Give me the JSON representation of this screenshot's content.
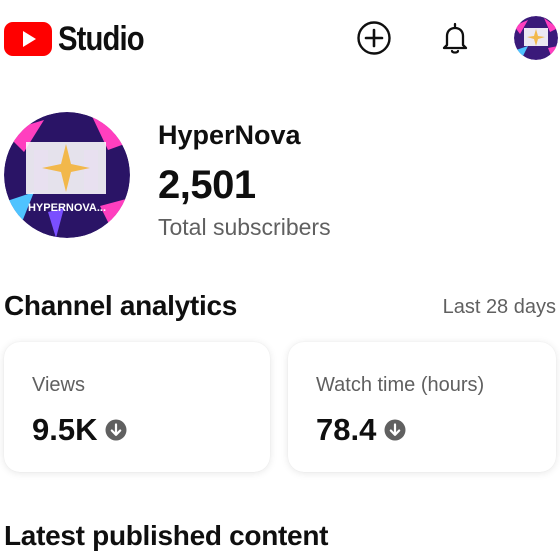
{
  "header": {
    "app_name": "Studio",
    "icons": [
      "youtube-logo-icon",
      "create-plus-icon",
      "bell-icon",
      "account-avatar"
    ]
  },
  "channel": {
    "name": "HyperNova",
    "subscriber_count": "2,501",
    "subscriber_label": "Total subscribers",
    "avatar_text": "HYPERNOVA..."
  },
  "analytics": {
    "title": "Channel analytics",
    "period": "Last 28 days",
    "cards": [
      {
        "label": "Views",
        "value": "9.5K",
        "trend": "down"
      },
      {
        "label": "Watch time (hours)",
        "value": "78.4",
        "trend": "down"
      }
    ]
  },
  "latest": {
    "title": "Latest published content"
  },
  "colors": {
    "brand_red": "#FF0000",
    "text_primary": "#0f0f0f",
    "text_secondary": "#606060",
    "avatar_purple": "#3a1a7a",
    "avatar_pink": "#ff3fbf"
  }
}
